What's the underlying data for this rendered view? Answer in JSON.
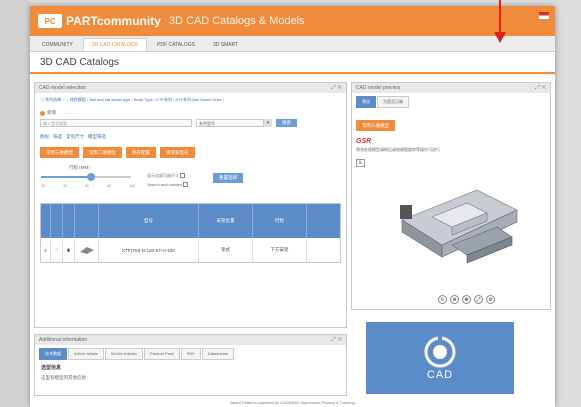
{
  "topbar": {
    "logo": "PC",
    "brand": "PARTcommunity",
    "title": "3D CAD Catalogs & Models"
  },
  "nav": {
    "tabs": [
      "COMMUNITY",
      "3D CAD CATALOGS",
      "PDF CATALOGS",
      "3D SMART"
    ]
  },
  "page_title": "3D CAD Catalogs",
  "selection_panel": {
    "title": "CAD model selection",
    "crumbs": "◁ 系列选择 › → 线性模组 › Ball and rail screw type › Body Type › KTF系列 › KTF系列-Ball Screw Drive ›",
    "radio_label": "新增",
    "select_value": "系列型号",
    "search_placeholder": "输入型号搜索",
    "search_button": "搜索",
    "options_line": "图视 · 筛选 · 常见尺寸 · 模型筛选",
    "buttons": [
      "常用三维模型",
      "常用二维模型",
      "保存配置",
      "请求新型号"
    ],
    "slider_label": "行程 (MM)",
    "slider_ticks": [
      "30",
      "40",
      "50",
      "60",
      "100"
    ],
    "check1": "显示全部可选尺寸",
    "check2": "Search auto-related",
    "reset_button": "重置选择",
    "table": {
      "headers": [
        "",
        "",
        "",
        "",
        "型号",
        "安装位置",
        "行程",
        ""
      ],
      "row": [
        "4",
        "♡",
        "⬮",
        "",
        "KTF(TM)-D-120-ST-H-100",
        "架式",
        "下方安装",
        ""
      ]
    }
  },
  "info_panel": {
    "title": "Additional information",
    "tabs": [
      "技术数据",
      "Article details",
      "Similar Articles",
      "Product Pack",
      "PDF",
      "Datasheets"
    ],
    "heading": "选型信息",
    "body": "这里有模型的其他信息"
  },
  "preview_panel": {
    "title": "CAD model preview",
    "tabs": [
      "预览",
      "为是否正确"
    ],
    "button": "常用三维模型",
    "note": "预览处理模型请稍后或按键图旋转等操作可进行",
    "logo": "GSR"
  },
  "cad_logo": {
    "text": "CAD"
  },
  "footer": "About PartsPro powered by CADENAS Impressum Privacy & Tracking",
  "colors": {
    "accent": "#ef8b3a",
    "blue": "#5b8cc8",
    "red_arrow": "#e02020"
  }
}
